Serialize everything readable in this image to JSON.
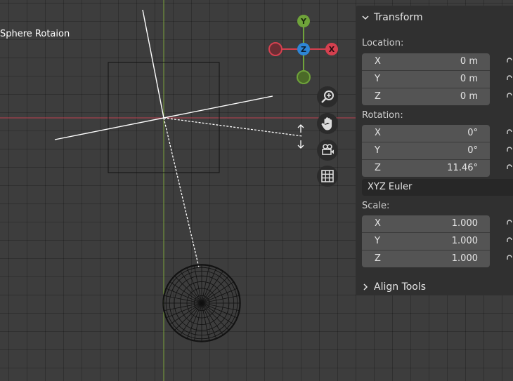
{
  "viewport": {
    "title": "Sphere Rotaion",
    "grid_color": "#3d3d3d",
    "x_axis_color": "#c0414f",
    "y_axis_color": "#7aa33a",
    "gizmo": {
      "x_label": "X",
      "y_label": "Y",
      "z_label": "Z",
      "x_color": "#d5404f",
      "y_color": "#6fa33a",
      "z_color": "#2e86d6"
    },
    "nav_buttons": [
      "zoom-icon",
      "hand-icon",
      "camera-icon",
      "grid-icon"
    ]
  },
  "panel": {
    "transform_header": "Transform",
    "location_label": "Location:",
    "location": [
      {
        "axis": "X",
        "value": "0 m"
      },
      {
        "axis": "Y",
        "value": "0 m"
      },
      {
        "axis": "Z",
        "value": "0 m"
      }
    ],
    "rotation_label": "Rotation:",
    "rotation": [
      {
        "axis": "X",
        "value": "0°"
      },
      {
        "axis": "Y",
        "value": "0°"
      },
      {
        "axis": "Z",
        "value": "11.46°"
      }
    ],
    "rotation_mode": "XYZ Euler",
    "scale_label": "Scale:",
    "scale": [
      {
        "axis": "X",
        "value": "1.000"
      },
      {
        "axis": "Y",
        "value": "1.000"
      },
      {
        "axis": "Z",
        "value": "1.000"
      }
    ],
    "align_tools_header": "Align Tools"
  }
}
